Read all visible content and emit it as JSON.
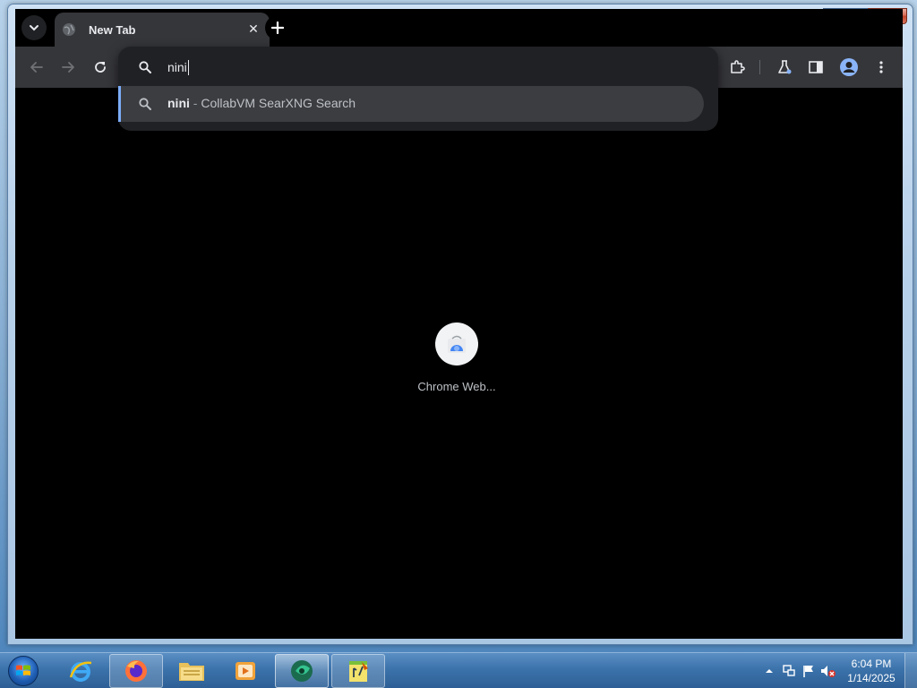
{
  "window": {
    "caption_minimize": "—",
    "caption_maximize": "❐",
    "caption_close": "✕"
  },
  "browser": {
    "tab": {
      "title": "New Tab",
      "close_glyph": "✕"
    },
    "omnibox": {
      "value": "nini",
      "suggestion": {
        "query": "nini",
        "separator": " - ",
        "engine": "CollabVM SearXNG Search"
      }
    },
    "shortcut": {
      "label": "Chrome Web..."
    }
  },
  "taskbar": {
    "items": [
      {
        "name": "internet-explorer"
      },
      {
        "name": "firefox"
      },
      {
        "name": "file-explorer"
      },
      {
        "name": "media-player"
      },
      {
        "name": "app-green",
        "active": true
      },
      {
        "name": "app-notepad"
      }
    ],
    "clock": {
      "time": "6:04 PM",
      "date": "1/14/2025"
    }
  },
  "colors": {
    "toolbar": "#35363a",
    "omnibox": "#202124",
    "suggestion_highlight": "#3c3d41",
    "accent": "#7cacf8",
    "page_background": "#000000"
  }
}
